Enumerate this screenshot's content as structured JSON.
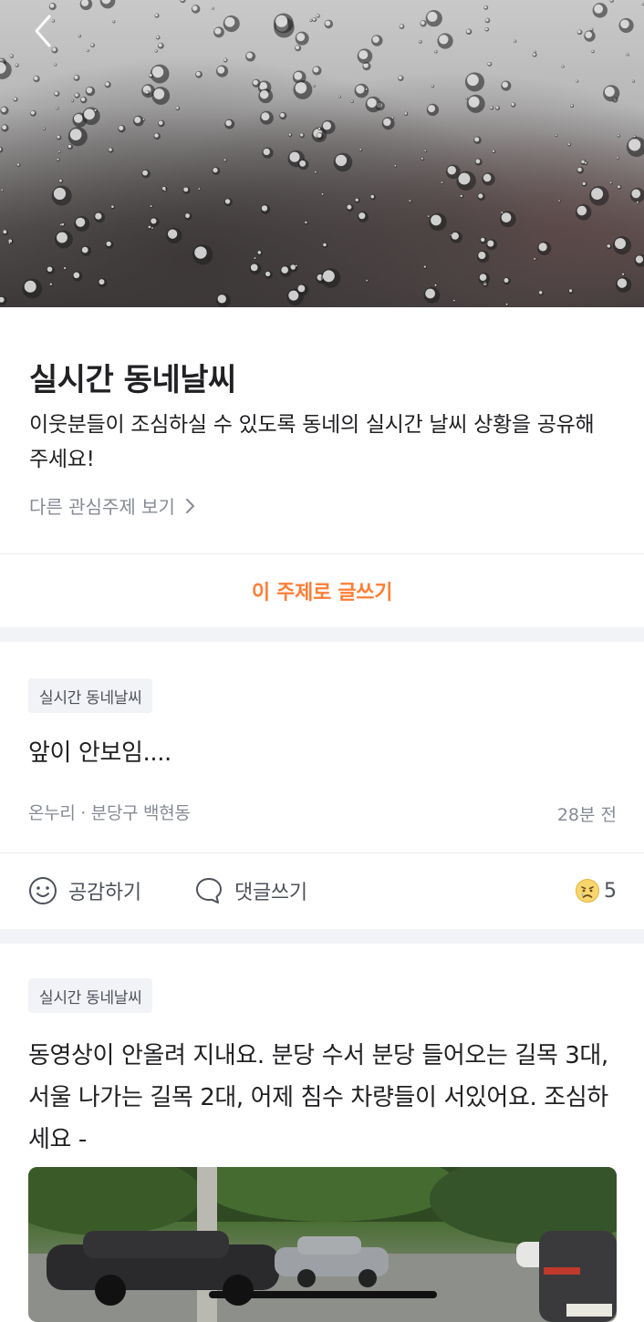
{
  "header": {
    "back_icon": "chevron-left-icon"
  },
  "topic": {
    "title": "실시간 동네날씨",
    "description": "이웃분들이 조심하실 수 있도록 동네의 실시간 날씨 상황을 공유해주세요!",
    "other_topics_label": "다른 관심주제 보기"
  },
  "write_button_label": "이 주제로 글쓰기",
  "colors": {
    "accent": "#ff7e36",
    "muted": "#868b94",
    "separator": "#f2f3f6"
  },
  "posts": [
    {
      "tag": "실시간 동네날씨",
      "body": "앞이 안보임....",
      "author_location": "온누리 · 분당구 백현동",
      "time": "28분 전",
      "like_label": "공감하기",
      "comment_label": "댓글쓰기",
      "reaction_icon": "sad-face-icon",
      "reaction_count": "5"
    },
    {
      "tag": "실시간 동네날씨",
      "body": "동영상이 안올려 지내요. 분당 수서 분당 들어오는 길목 3대, 서울 나가는 길목 2대, 어제 침수 차량들이 서있어요. 조심하세요 -"
    }
  ]
}
